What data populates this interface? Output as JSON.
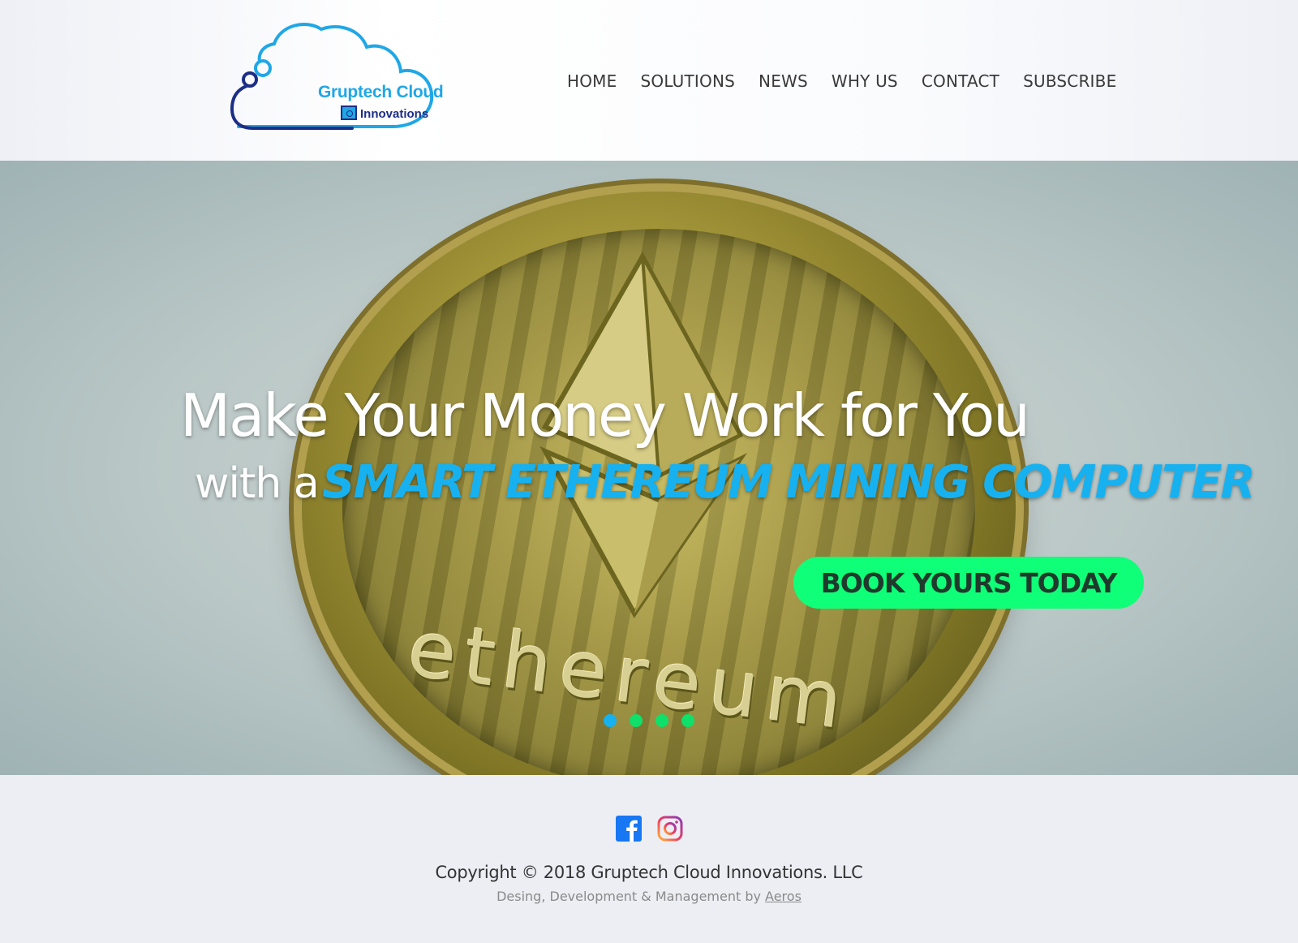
{
  "brand": {
    "name_line1": "Gruptech Cloud",
    "name_line2": "Innovations",
    "colors": {
      "light_blue": "#1fa7e6",
      "dark_blue": "#1c2f86"
    }
  },
  "nav": {
    "items": [
      {
        "label": "HOME"
      },
      {
        "label": "SOLUTIONS"
      },
      {
        "label": "NEWS"
      },
      {
        "label": "WHY US"
      },
      {
        "label": "CONTACT"
      },
      {
        "label": "SUBSCRIBE"
      }
    ]
  },
  "hero": {
    "title": "Make Your Money Work for You",
    "subtitle_prefix": "with a",
    "subtitle_accent": "SMART ETHEREUM MINING COMPUTER",
    "coin_text": "ethereum",
    "cta_label": "BOOK YOURS TODAY",
    "accent_color": "#17b1f0",
    "cta_color": "#0fff78",
    "slides": [
      {
        "active": true,
        "color": "#17b1f0"
      },
      {
        "active": false,
        "color": "#0fe06a"
      },
      {
        "active": false,
        "color": "#0fe06a"
      },
      {
        "active": false,
        "color": "#0fe06a"
      }
    ]
  },
  "footer": {
    "social": [
      {
        "icon": "facebook-icon",
        "label": "Facebook"
      },
      {
        "icon": "instagram-icon",
        "label": "Instagram"
      }
    ],
    "copyright": "Copyright © 2018 Gruptech Cloud Innovations. LLC",
    "credits_prefix": "Desing, Development & Management by ",
    "credits_link": "Aeros"
  }
}
